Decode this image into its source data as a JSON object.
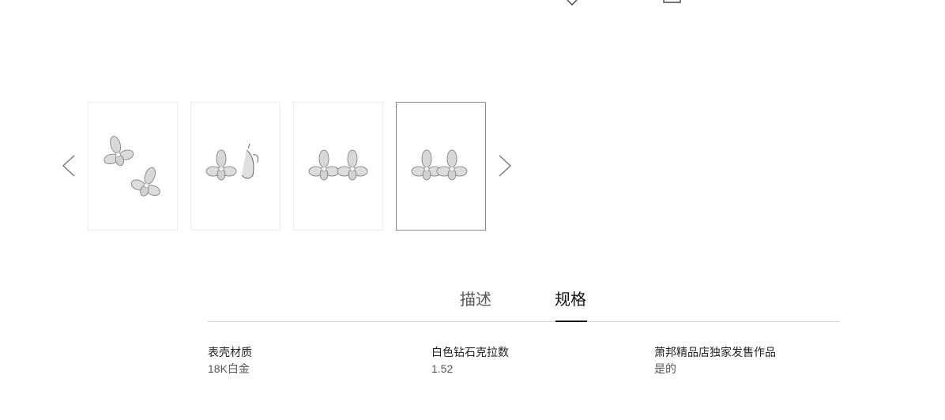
{
  "top_icons": [
    "heart-icon",
    "bag-icon"
  ],
  "gallery": {
    "prev_icon": "chevron-left-icon",
    "next_icon": "chevron-right-icon",
    "thumbnails": [
      {
        "view": "pair-scattered"
      },
      {
        "view": "front-and-side"
      },
      {
        "view": "pair-front"
      },
      {
        "view": "pair-back"
      }
    ],
    "selected_index": 3
  },
  "tabs": [
    {
      "label": "描述",
      "active": false
    },
    {
      "label": "规格",
      "active": true
    }
  ],
  "specs": [
    {
      "label": "表壳材质",
      "value": "18K白金"
    },
    {
      "label": "白色钻石克拉数",
      "value": "1.52"
    },
    {
      "label": "萧邦精品店独家发售作品",
      "value": "是的"
    }
  ],
  "colors": {
    "active_tab": "#111111",
    "inactive_tab": "#555555",
    "rule": "#d4d4d4",
    "selected_border": "#8a8a8a"
  }
}
